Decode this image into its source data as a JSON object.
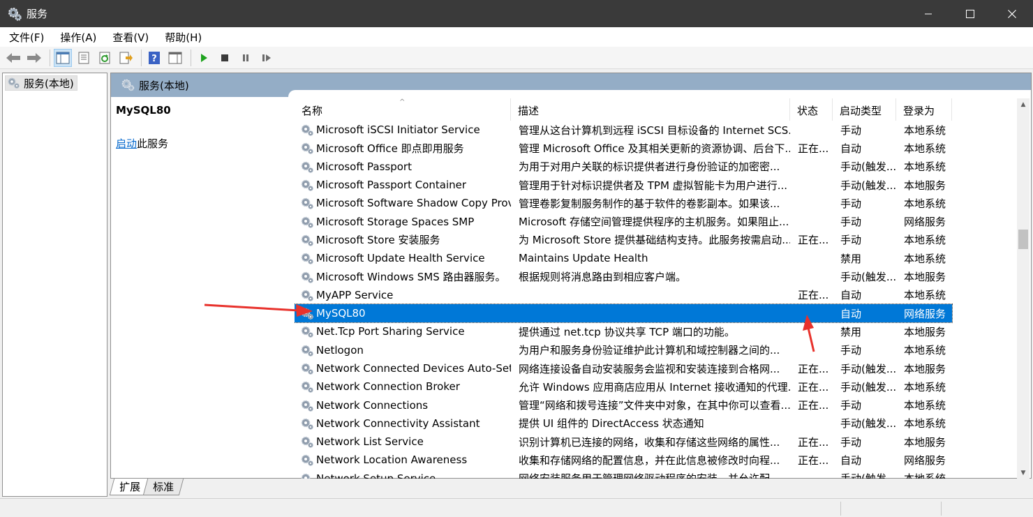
{
  "window": {
    "title": "服务"
  },
  "menu": [
    "文件(F)",
    "操作(A)",
    "查看(V)",
    "帮助(H)"
  ],
  "tree": {
    "root_label": "服务(本地)"
  },
  "pane": {
    "header_title": "服务(本地)",
    "selected_service": "MySQL80",
    "action_link": "启动",
    "action_suffix": "此服务"
  },
  "columns": {
    "name": "名称",
    "desc": "描述",
    "status": "状态",
    "startup": "启动类型",
    "logon": "登录为"
  },
  "rows": [
    {
      "name": "Microsoft iSCSI Initiator Service",
      "desc": "管理从这台计算机到远程 iSCSI 目标设备的 Internet SCS...",
      "status": "",
      "startup": "手动",
      "logon": "本地系统"
    },
    {
      "name": "Microsoft Office 即点即用服务",
      "desc": "管理 Microsoft Office 及其相关更新的资源协调、后台下...",
      "status": "正在...",
      "startup": "自动",
      "logon": "本地系统"
    },
    {
      "name": "Microsoft Passport",
      "desc": "为用于对用户关联的标识提供者进行身份验证的加密密...",
      "status": "",
      "startup": "手动(触发...",
      "logon": "本地系统"
    },
    {
      "name": "Microsoft Passport Container",
      "desc": "管理用于针对标识提供者及 TPM 虚拟智能卡为用户进行...",
      "status": "",
      "startup": "手动(触发...",
      "logon": "本地服务"
    },
    {
      "name": "Microsoft Software Shadow Copy Provi...",
      "desc": "管理卷影复制服务制作的基于软件的卷影副本。如果该...",
      "status": "",
      "startup": "手动",
      "logon": "本地系统"
    },
    {
      "name": "Microsoft Storage Spaces SMP",
      "desc": "Microsoft 存储空间管理提供程序的主机服务。如果阻止...",
      "status": "",
      "startup": "手动",
      "logon": "网络服务"
    },
    {
      "name": "Microsoft Store 安装服务",
      "desc": "为 Microsoft Store 提供基础结构支持。此服务按需启动...",
      "status": "正在...",
      "startup": "手动",
      "logon": "本地系统"
    },
    {
      "name": "Microsoft Update Health Service",
      "desc": "Maintains Update Health",
      "status": "",
      "startup": "禁用",
      "logon": "本地系统"
    },
    {
      "name": "Microsoft Windows SMS 路由器服务。",
      "desc": "根据规则将消息路由到相应客户端。",
      "status": "",
      "startup": "手动(触发...",
      "logon": "本地服务"
    },
    {
      "name": "MyAPP Service",
      "desc": "",
      "status": "正在...",
      "startup": "自动",
      "logon": "本地系统"
    },
    {
      "name": "MySQL80",
      "desc": "",
      "status": "",
      "startup": "自动",
      "logon": "网络服务"
    },
    {
      "name": "Net.Tcp Port Sharing Service",
      "desc": "提供通过 net.tcp 协议共享 TCP 端口的功能。",
      "status": "",
      "startup": "禁用",
      "logon": "本地服务"
    },
    {
      "name": "Netlogon",
      "desc": "为用户和服务身份验证维护此计算机和域控制器之间的...",
      "status": "",
      "startup": "手动",
      "logon": "本地系统"
    },
    {
      "name": "Network Connected Devices Auto-Setup",
      "desc": "网络连接设备自动安装服务会监视和安装连接到合格网...",
      "status": "正在...",
      "startup": "手动(触发...",
      "logon": "本地服务"
    },
    {
      "name": "Network Connection Broker",
      "desc": "允许 Windows 应用商店应用从 Internet 接收通知的代理...",
      "status": "正在...",
      "startup": "手动(触发...",
      "logon": "本地系统"
    },
    {
      "name": "Network Connections",
      "desc": "管理“网络和拨号连接”文件夹中对象，在其中你可以查看...",
      "status": "正在...",
      "startup": "手动",
      "logon": "本地系统"
    },
    {
      "name": "Network Connectivity Assistant",
      "desc": "提供 UI 组件的 DirectAccess 状态通知",
      "status": "",
      "startup": "手动(触发...",
      "logon": "本地系统"
    },
    {
      "name": "Network List Service",
      "desc": "识别计算机已连接的网络，收集和存储这些网络的属性...",
      "status": "正在...",
      "startup": "手动",
      "logon": "本地服务"
    },
    {
      "name": "Network Location Awareness",
      "desc": "收集和存储网络的配置信息，并在此信息被修改时向程...",
      "status": "正在...",
      "startup": "自动",
      "logon": "网络服务"
    },
    {
      "name": "Network Setup Service",
      "desc": "网络安装服务用于管理网络驱动程序的安装，并允许配...",
      "status": "",
      "startup": "手动(触发...",
      "logon": "本地系统"
    }
  ],
  "selected_index": 10,
  "tabs": [
    "扩展",
    "标准"
  ],
  "colors": {
    "selection": "#0078d7",
    "header": "#94adc6",
    "annotation_arrow": "#e8322c"
  }
}
